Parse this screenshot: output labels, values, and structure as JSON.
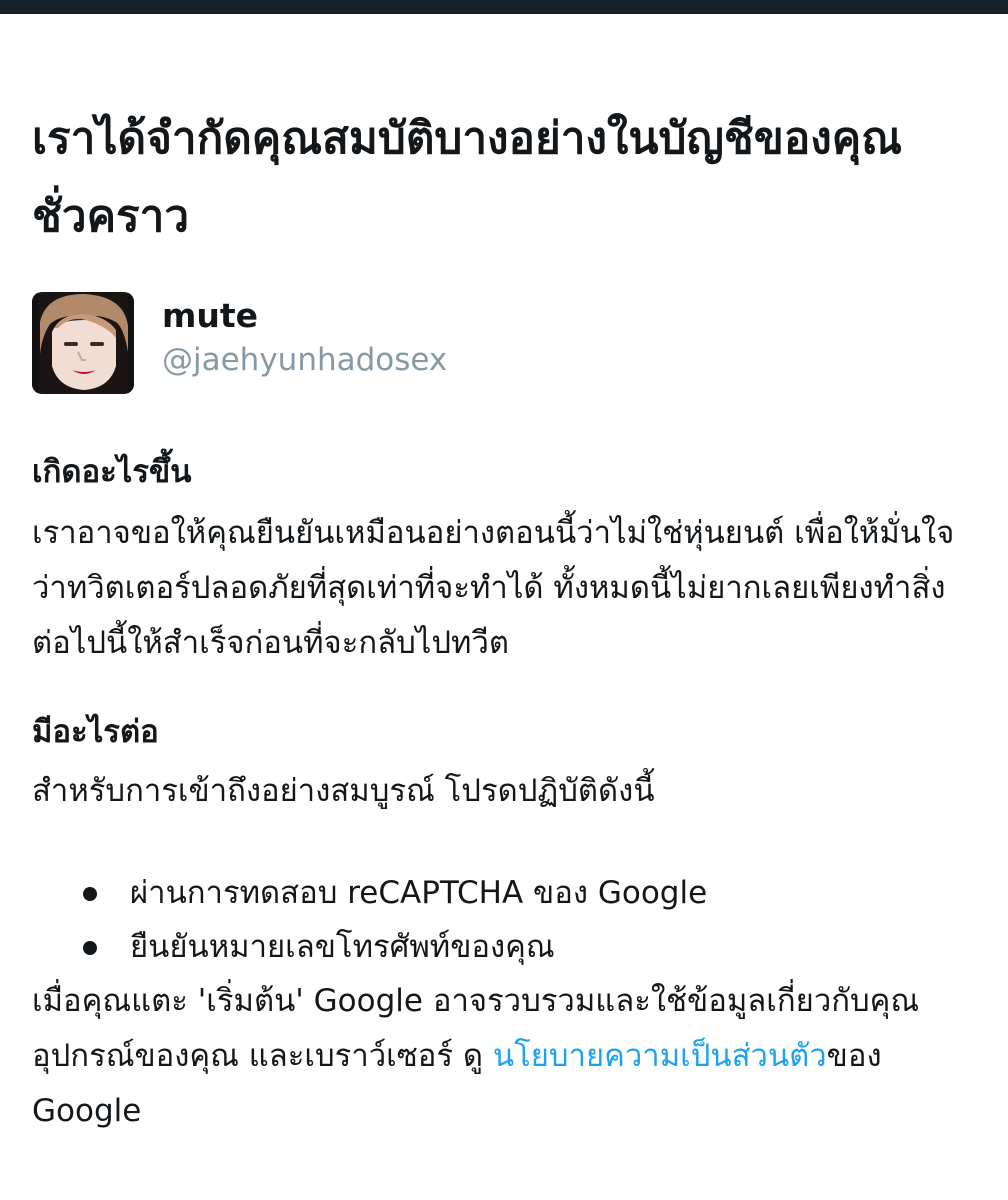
{
  "title": "เราได้จำกัดคุณสมบัติบางอย่างในบัญชีของคุณชั่วคราว",
  "account": {
    "display_name": "mute",
    "handle": "@jaehyunhadosex"
  },
  "what_happened": {
    "heading": "เกิดอะไรขึ้น",
    "body": "เราอาจขอให้คุณยืนยันเหมือนอย่างตอนนี้ว่าไม่ใช่หุ่นยนต์ เพื่อให้มั่นใจว่าทวิตเตอร์ปลอดภัยที่สุดเท่าที่จะทำได้ ทั้งหมดนี้ไม่ยากเลยเพียงทำสิ่งต่อไปนี้ให้สำเร็จก่อนที่จะกลับไปทวีต"
  },
  "whats_next": {
    "heading": "มีอะไรต่อ",
    "intro": "สำหรับการเข้าถึงอย่างสมบูรณ์ โปรดปฏิบัติดังนี้",
    "steps": [
      "ผ่านการทดสอบ reCAPTCHA ของ Google",
      "ยืนยันหมายเลขโทรศัพท์ของคุณ"
    ]
  },
  "notice": {
    "text_before": "เมื่อคุณแตะ 'เริ่มต้น' Google อาจรวบรวมและใช้ข้อมูลเกี่ยวกับคุณ อุปกรณ์ของคุณ และเบราว์เซอร์ ดู ",
    "link_text": "นโยบายความเป็นส่วนตัว",
    "text_after": "ของ Google"
  },
  "colors": {
    "link": "#1da1f2",
    "handle": "#8899a6",
    "topbar": "#15202b"
  }
}
